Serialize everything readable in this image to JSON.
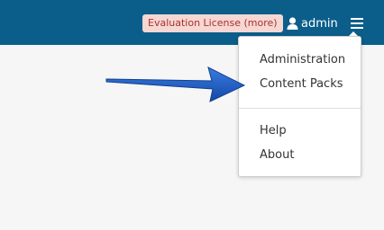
{
  "header": {
    "license_badge": "Evaluation License (more)",
    "user_label": "admin",
    "user_icon": "user-icon",
    "menu_icon": "hamburger-menu-icon",
    "bar_color": "#0b5e8a"
  },
  "dropdown": {
    "items": [
      {
        "label": "Administration"
      },
      {
        "label": "Content Packs"
      },
      {
        "label": "Help"
      },
      {
        "label": "About"
      }
    ]
  },
  "annotation": {
    "arrow_icon": "pointer-arrow",
    "arrow_color": "#1f5fc2"
  }
}
